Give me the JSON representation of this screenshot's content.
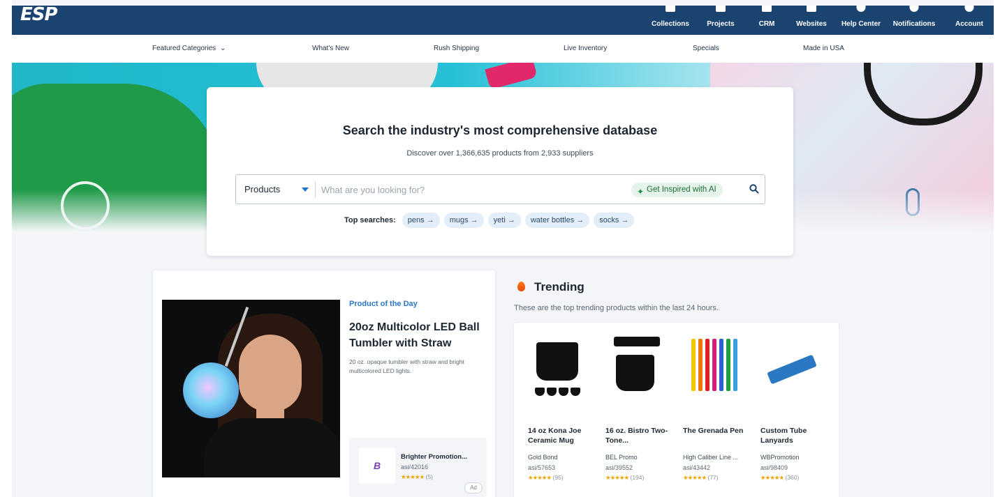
{
  "header": {
    "logo": "ESP",
    "nav": [
      {
        "label": "Collections",
        "icon": "collections-icon"
      },
      {
        "label": "Projects",
        "icon": "projects-icon"
      },
      {
        "label": "CRM",
        "icon": "crm-icon"
      },
      {
        "label": "Websites",
        "icon": "websites-icon"
      },
      {
        "label": "Help Center",
        "icon": "help-icon"
      },
      {
        "label": "Notifications",
        "icon": "bell-icon"
      },
      {
        "label": "Account",
        "icon": "account-icon"
      }
    ]
  },
  "subnav": {
    "featured": "Featured Categories",
    "items": [
      "What's New",
      "Rush Shipping",
      "Live Inventory",
      "Specials",
      "Made in USA"
    ]
  },
  "search": {
    "title": "Search the industry's most comprehensive database",
    "subtitle": "Discover over 1,366,635 products from 2,933 suppliers",
    "scope": "Products",
    "placeholder": "What are you looking for?",
    "ai_label": "Get Inspired with AI",
    "top_label": "Top searches:",
    "top_searches": [
      "pens →",
      "mugs →",
      "yeti →",
      "water bottles →",
      "socks →"
    ]
  },
  "product_of_day": {
    "kicker": "Product of the Day",
    "title": "20oz Multicolor LED Ball Tumbler with Straw",
    "description": "20 oz. opaque tumbler with straw and bright multicolored LED lights.",
    "supplier": {
      "name": "Brighter Promotion...",
      "asi": "asi/42016",
      "stars": "★★★★★",
      "reviews": "(5)",
      "ad": "Ad"
    }
  },
  "trending": {
    "title": "Trending",
    "subtitle": "These are the top trending products within the last 24 hours.",
    "items": [
      {
        "name": "14 oz Kona Joe Ceramic Mug",
        "supplier": "Gold Bond",
        "asi": "asi/57653",
        "stars": "★★★★★",
        "reviews": "(95)"
      },
      {
        "name": "16 oz. Bistro Two-Tone...",
        "supplier": "BEL Promo",
        "asi": "asi/39552",
        "stars": "★★★★★",
        "reviews": "(194)"
      },
      {
        "name": "The Grenada Pen",
        "supplier": "High Caliber Line ...",
        "asi": "asi/43442",
        "stars": "★★★★★",
        "reviews": "(77)"
      },
      {
        "name": "Custom Tube Lanyards",
        "supplier": "WBPromotion",
        "asi": "asi/98409",
        "stars": "★★★★★",
        "reviews": "(360)"
      }
    ]
  },
  "colors": {
    "header_bg": "#1b4370",
    "accent_blue": "#2a78c6",
    "star": "#f0a400",
    "ai_green": "#1e8c4a"
  }
}
